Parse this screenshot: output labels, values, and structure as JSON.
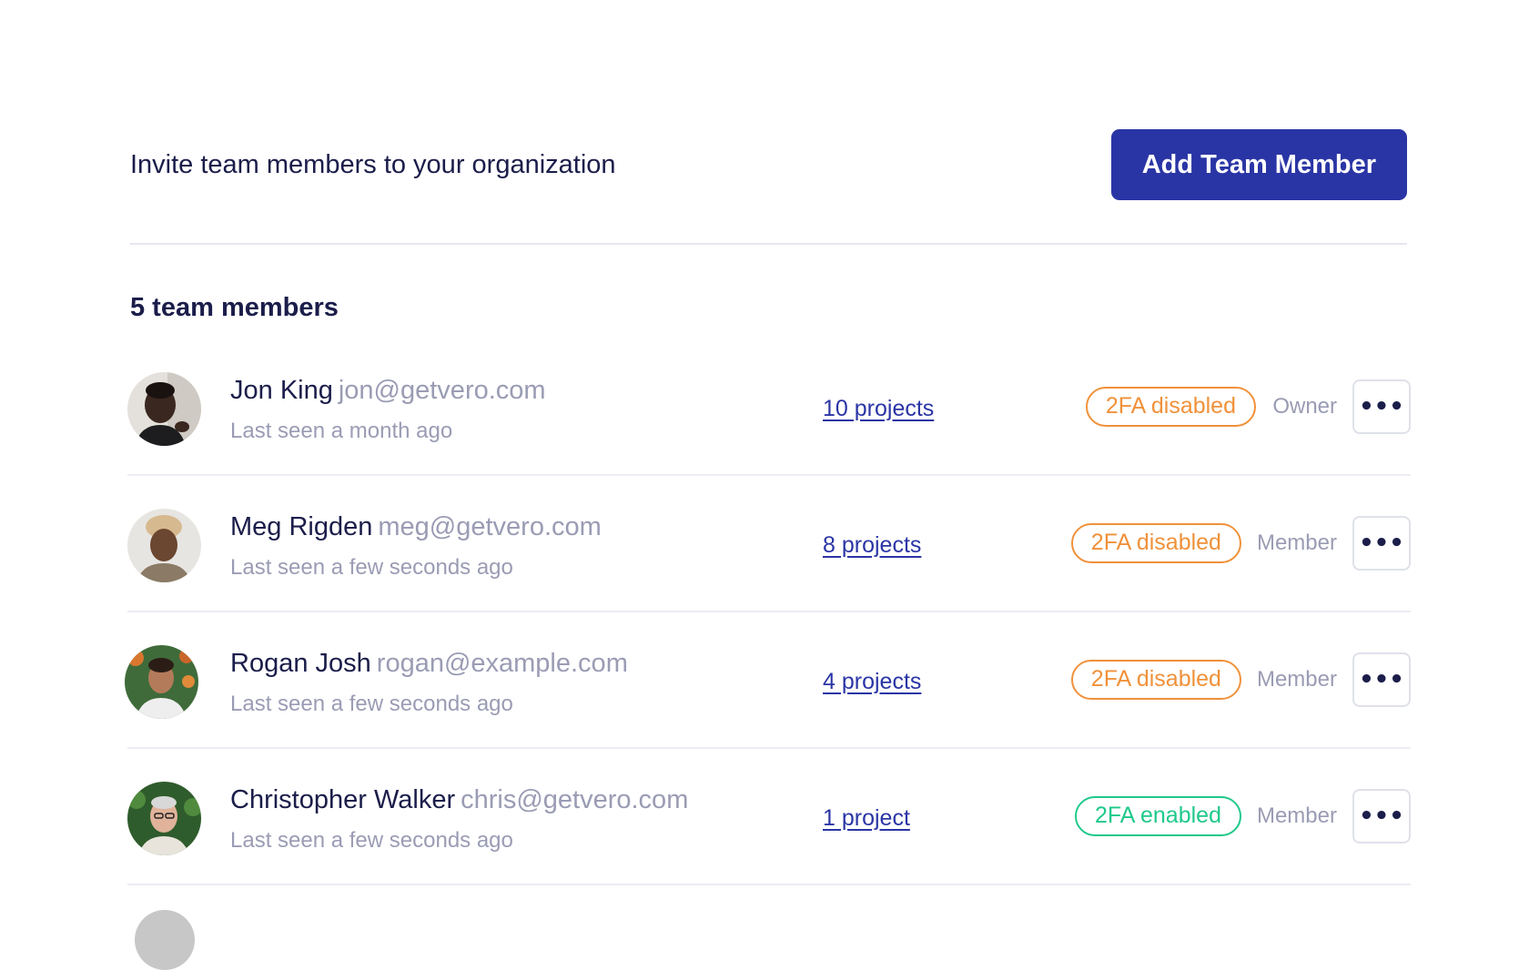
{
  "header": {
    "intro_text": "Invite team members to your organization",
    "add_button_label": "Add Team Member"
  },
  "member_count_label": "5 team members",
  "members": [
    {
      "name": "Jon King",
      "email": "jon@getvero.com",
      "last_seen": "Last seen a month ago",
      "projects": "10 projects",
      "twofa": "2FA disabled",
      "twofa_status": "disabled",
      "role": "Owner",
      "more_label": "•••"
    },
    {
      "name": "Meg Rigden",
      "email": "meg@getvero.com",
      "last_seen": "Last seen a few seconds ago",
      "projects": "8 projects",
      "twofa": "2FA disabled",
      "twofa_status": "disabled",
      "role": "Member",
      "more_label": "•••"
    },
    {
      "name": "Rogan Josh",
      "email": "rogan@example.com",
      "last_seen": "Last seen a few seconds ago",
      "projects": "4 projects",
      "twofa": "2FA disabled",
      "twofa_status": "disabled",
      "role": "Member",
      "more_label": "•••"
    },
    {
      "name": "Christopher Walker",
      "email": "chris@getvero.com",
      "last_seen": "Last seen a few seconds ago",
      "projects": "1 project",
      "twofa": "2FA enabled",
      "twofa_status": "enabled",
      "role": "Member",
      "more_label": "•••"
    }
  ],
  "colors": {
    "accent": "#2a35a5",
    "disabled": "#f0913a",
    "enabled": "#1fc98a",
    "muted_text": "#9a9cb4",
    "primary_text": "#1b1d4a"
  }
}
